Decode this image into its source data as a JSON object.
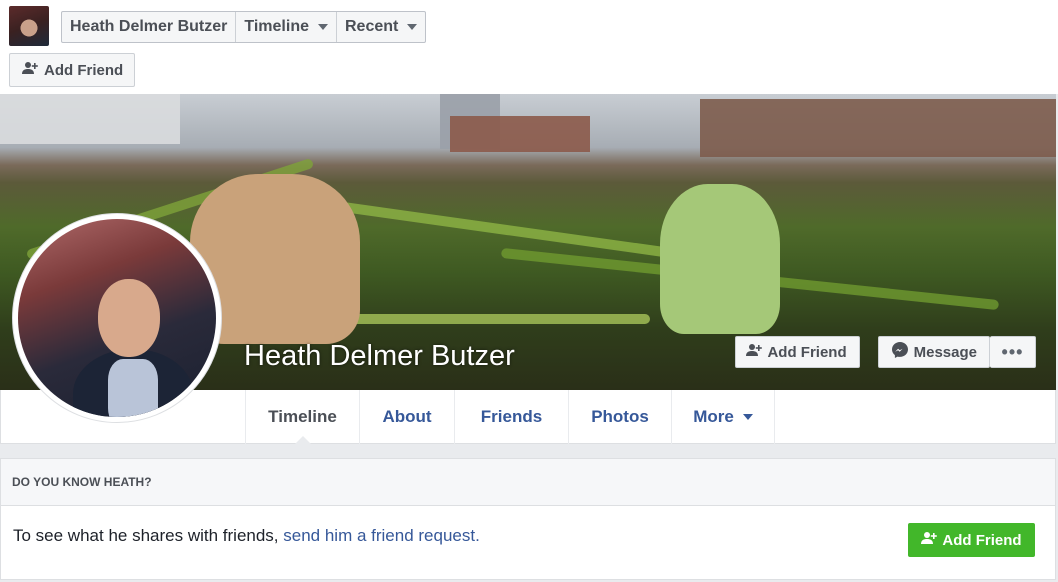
{
  "topbar": {
    "breadcrumbs": [
      {
        "label": "Heath Delmer Butzer"
      },
      {
        "label": "Timeline"
      },
      {
        "label": "Recent"
      }
    ],
    "add_friend_label": "Add Friend"
  },
  "cover": {
    "name": "Heath Delmer Butzer",
    "add_friend_label": "Add Friend",
    "message_label": "Message",
    "more_label": "•••"
  },
  "tabs": [
    {
      "label": "Timeline",
      "active": true
    },
    {
      "label": "About"
    },
    {
      "label": "Friends"
    },
    {
      "label": "Photos"
    },
    {
      "label": "More"
    }
  ],
  "know": {
    "heading": "DO YOU KNOW HEATH?",
    "text": "To see what he shares with friends, ",
    "link": "send him a friend request.",
    "button_label": "Add Friend"
  },
  "colors": {
    "link_blue": "#365899",
    "green": "#42b72a",
    "bg": "#e9ebee"
  }
}
